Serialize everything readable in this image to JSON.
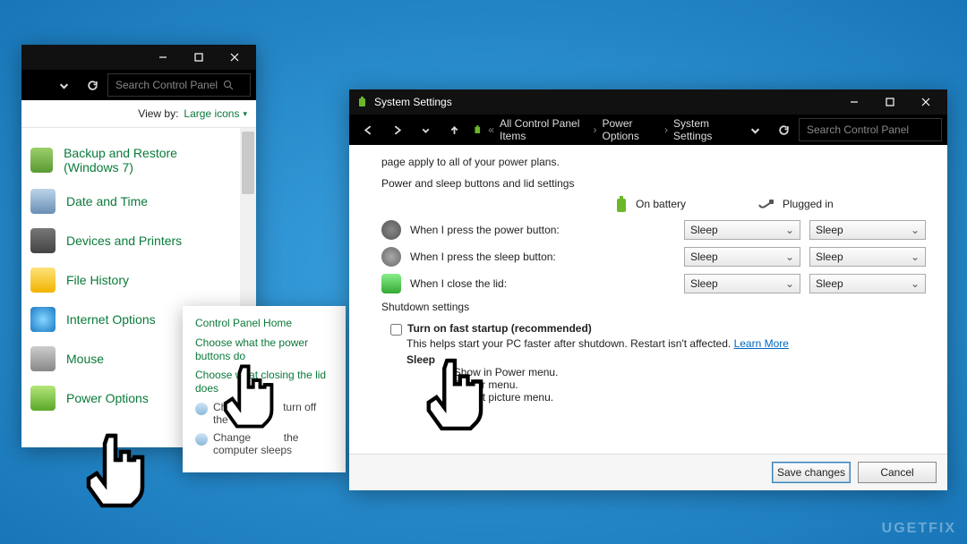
{
  "cp": {
    "search_placeholder": "Search Control Panel",
    "view_by_label": "View by:",
    "view_by_value": "Large icons",
    "items": [
      {
        "label": "Backup and Restore (Windows 7)"
      },
      {
        "label": "Date and Time"
      },
      {
        "label": "Devices and Printers"
      },
      {
        "label": "File History"
      },
      {
        "label": "Internet Options"
      },
      {
        "label": "Mouse"
      },
      {
        "label": "Power Options"
      }
    ]
  },
  "popout": {
    "home": "Control Panel Home",
    "link_power_buttons": "Choose what the power buttons do",
    "link_lid": "Choose what closing the lid does",
    "link_turn_off_display_a": "Choose",
    "link_turn_off_display_b": "turn off the display",
    "link_sleeps_a": "Change",
    "link_sleeps_b": "the computer sleeps"
  },
  "sys": {
    "title": "System Settings",
    "breadcrumbs": [
      "All Control Panel Items",
      "Power Options",
      "System Settings"
    ],
    "search_placeholder": "Search Control Panel",
    "intro": "page apply to all of your power plans.",
    "sec1": "Power and sleep buttons and lid settings",
    "col_battery": "On battery",
    "col_plugged": "Plugged in",
    "rows": [
      {
        "label": "When I press the power button:",
        "battery": "Sleep",
        "plugged": "Sleep"
      },
      {
        "label": "When I press the sleep button:",
        "battery": "Sleep",
        "plugged": "Sleep"
      },
      {
        "label": "When I close the lid:",
        "battery": "Sleep",
        "plugged": "Sleep"
      }
    ],
    "sec2": "Shutdown settings",
    "fast_startup_label": "Turn on fast startup (recommended)",
    "fast_startup_help": "This helps start your PC faster after shutdown. Restart isn't affected. ",
    "learn_more": "Learn More",
    "sleep_label": "Sleep",
    "sleep_desc": "Show in Power menu.",
    "hibernate_desc": "Power menu.",
    "lock_desc": "account picture menu.",
    "save": "Save changes",
    "cancel": "Cancel"
  },
  "watermark": "UGETFIX"
}
